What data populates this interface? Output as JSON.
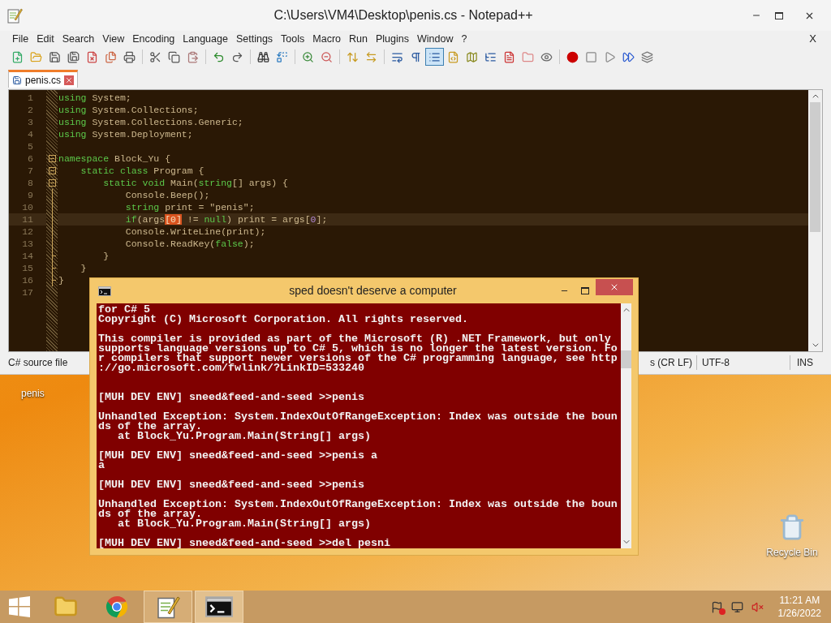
{
  "notepad": {
    "title": "C:\\Users\\VM4\\Desktop\\penis.cs - Notepad++",
    "menu": [
      "File",
      "Edit",
      "Search",
      "View",
      "Encoding",
      "Language",
      "Settings",
      "Tools",
      "Macro",
      "Run",
      "Plugins",
      "Window",
      "?"
    ],
    "close_document": "X",
    "toolbar": {
      "groups": [
        [
          {
            "selected": false
          },
          {
            "selected": false
          },
          {
            "selected": false
          },
          {
            "selected": false
          },
          {
            "selected": false
          },
          {
            "selected": false
          },
          {
            "selected": false
          }
        ],
        [
          {
            "selected": false
          },
          {
            "selected": false
          },
          {
            "selected": false
          }
        ],
        [
          {
            "selected": false
          },
          {
            "selected": false
          }
        ],
        [
          {
            "selected": false
          },
          {
            "selected": false
          }
        ],
        [
          {
            "selected": false
          },
          {
            "selected": false
          }
        ],
        [
          {
            "selected": false
          },
          {
            "selected": false
          }
        ],
        [
          {
            "selected": false
          },
          {
            "selected": false
          },
          {
            "selected": true
          },
          {
            "selected": false
          },
          {
            "selected": false
          },
          {
            "selected": false
          },
          {
            "selected": false
          },
          {
            "selected": false
          },
          {
            "selected": false
          }
        ],
        [
          {
            "selected": false
          },
          {
            "selected": false
          },
          {
            "selected": false
          },
          {
            "selected": false
          },
          {
            "selected": false
          }
        ]
      ]
    },
    "tabs": [
      {
        "label": "penis.cs",
        "selected": true
      }
    ],
    "editor": {
      "lines": [
        {
          "number": "1",
          "kind": "plain",
          "current": false,
          "tokens": [
            {
              "kind": "keyword",
              "text": "using"
            },
            {
              "kind": "text",
              "text": " System;"
            }
          ]
        },
        {
          "number": "2",
          "kind": "plain",
          "current": false,
          "tokens": [
            {
              "kind": "keyword",
              "text": "using"
            },
            {
              "kind": "text",
              "text": " System.Collections;"
            }
          ]
        },
        {
          "number": "3",
          "kind": "plain",
          "current": false,
          "tokens": [
            {
              "kind": "keyword",
              "text": "using"
            },
            {
              "kind": "text",
              "text": " System.Collections.Generic;"
            }
          ]
        },
        {
          "number": "4",
          "kind": "plain",
          "current": false,
          "tokens": [
            {
              "kind": "keyword",
              "text": "using"
            },
            {
              "kind": "text",
              "text": " System.Deployment;"
            }
          ]
        },
        {
          "number": "5",
          "kind": "plain",
          "current": false
        },
        {
          "number": "6",
          "kind": "opener",
          "current": false,
          "tokens": [
            {
              "kind": "keyword",
              "text": "namespace"
            },
            {
              "kind": "text",
              "text": " Block_Yu {"
            }
          ]
        },
        {
          "number": "7",
          "kind": "opener",
          "current": false,
          "tokens": [
            {
              "kind": "keyword",
              "text": "    static"
            },
            {
              "kind": "keyword",
              "text": " class"
            },
            {
              "kind": "text",
              "text": " Program {"
            }
          ]
        },
        {
          "number": "8",
          "kind": "opener",
          "current": false,
          "tokens": [
            {
              "kind": "keyword",
              "text": "        static"
            },
            {
              "kind": "keyword",
              "text": " void"
            },
            {
              "kind": "text",
              "text": " Main("
            },
            {
              "kind": "keyword",
              "text": "string"
            },
            {
              "kind": "text",
              "text": "[] args) {"
            }
          ]
        },
        {
          "number": "9",
          "kind": "inner",
          "current": false,
          "tokens": [
            {
              "kind": "text",
              "text": "            Console.Beep();"
            }
          ]
        },
        {
          "number": "10",
          "kind": "inner",
          "current": false,
          "tokens": [
            {
              "kind": "keyword",
              "text": "            string"
            },
            {
              "kind": "text",
              "text": " print = \"penis\";"
            }
          ]
        },
        {
          "number": "11",
          "kind": "inner",
          "current": true,
          "tokens": [
            {
              "kind": "keyword",
              "text": "            if"
            },
            {
              "kind": "text",
              "text": "(args"
            },
            {
              "kind": "brace",
              "text": "[0]"
            },
            {
              "kind": "text",
              "text": " != "
            },
            {
              "kind": "keyword",
              "text": "null"
            },
            {
              "kind": "text",
              "text": ") print = args["
            },
            {
              "kind": "number",
              "text": "0"
            },
            {
              "kind": "text",
              "text": "];"
            }
          ]
        },
        {
          "number": "12",
          "kind": "inner",
          "current": false,
          "tokens": [
            {
              "kind": "text",
              "text": "            Console.WriteLine(print);"
            }
          ]
        },
        {
          "number": "13",
          "kind": "inner",
          "current": false,
          "tokens": [
            {
              "kind": "text",
              "text": "            Console.ReadKey("
            },
            {
              "kind": "keyword",
              "text": "false"
            },
            {
              "kind": "text",
              "text": ");"
            }
          ]
        },
        {
          "number": "14",
          "kind": "closer",
          "current": false,
          "tokens": [
            {
              "kind": "text",
              "text": "        }"
            }
          ]
        },
        {
          "number": "15",
          "kind": "closer",
          "current": false,
          "tokens": [
            {
              "kind": "text",
              "text": "    }"
            }
          ]
        },
        {
          "number": "16",
          "kind": "closer",
          "current": false,
          "tokens": [
            {
              "kind": "text",
              "text": "}"
            }
          ]
        },
        {
          "number": "17",
          "kind": "plain",
          "current": false
        }
      ]
    },
    "status_bar": {
      "file_type": "C# source file",
      "line_endings": "s (CR LF)",
      "encoding": "UTF-8",
      "mode": "INS"
    }
  },
  "desktop": {
    "file_label": "penis",
    "recycle_bin_label": "Recycle Bin"
  },
  "console": {
    "title": "sped doesn't deserve a computer",
    "blocks": [
      {
        "kind": "top",
        "lines": [
          "for C# 5",
          "Copyright (C) Microsoft Corporation. All rights reserved."
        ]
      },
      {
        "kind": "spaced",
        "lines": [
          "This compiler is provided as part of the Microsoft (R) .NET Framework, but only",
          "supports language versions up to C# 5, which is no longer the latest version. Fo",
          "r compilers that support newer versions of the C# programming language, see http",
          "://go.microsoft.com/fwlink/?LinkID=533240"
        ]
      },
      {
        "kind": "wide",
        "lines": [
          "[MUH DEV ENV] sneed&feed-and-seed >>penis"
        ]
      },
      {
        "kind": "spaced",
        "lines": [
          "Unhandled Exception: System.IndexOutOfRangeException: Index was outside the boun",
          "ds of the array.",
          "   at Block_Yu.Program.Main(String[] args)"
        ]
      },
      {
        "kind": "spaced",
        "lines": [
          "[MUH DEV ENV] sneed&feed-and-seed >>penis a",
          "a"
        ]
      },
      {
        "kind": "spaced",
        "lines": [
          "[MUH DEV ENV] sneed&feed-and-seed >>penis"
        ]
      },
      {
        "kind": "spaced",
        "lines": [
          "Unhandled Exception: System.IndexOutOfRangeException: Index was outside the boun",
          "ds of the array.",
          "   at Block_Yu.Program.Main(String[] args)"
        ]
      },
      {
        "kind": "spaced",
        "lines": [
          "[MUH DEV ENV] sneed&feed-and-seed >>del pesni"
        ]
      }
    ]
  },
  "taskbar": {
    "items": [
      {
        "running": false,
        "selected": false
      },
      {
        "running": false,
        "selected": false
      },
      {
        "running": true,
        "selected": false
      },
      {
        "running": true,
        "selected": true
      }
    ],
    "clock": {
      "time": "11:21 AM",
      "date": "1/26/2022"
    }
  }
}
